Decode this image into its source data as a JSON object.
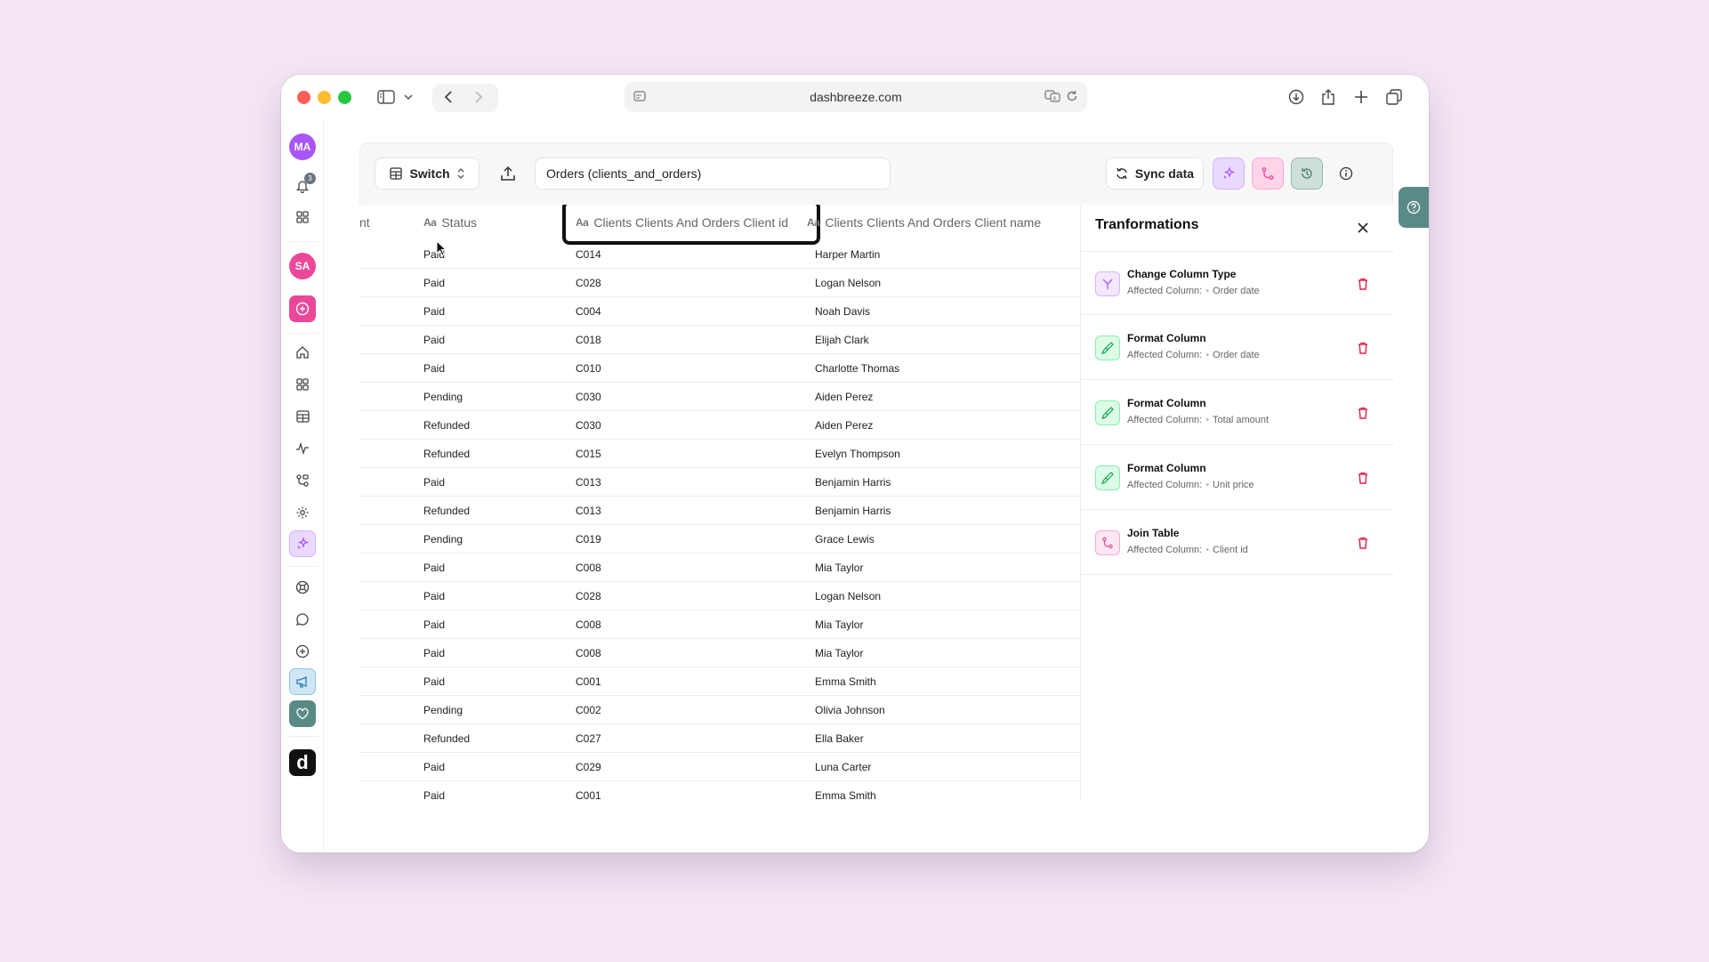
{
  "browser": {
    "url": "dashbreeze.com"
  },
  "sidebar": {
    "user_initials": "MA",
    "notification_count": "3",
    "workspace_initials": "SA",
    "logo_letter": "d"
  },
  "toolbar": {
    "switch_label": "Switch",
    "dataset_name": "Orders (clients_and_orders)",
    "sync_label": "Sync data"
  },
  "table": {
    "columns": [
      {
        "label": "nt"
      },
      {
        "label": "Status"
      },
      {
        "label": "Clients Clients And Orders Client id"
      },
      {
        "label": "Clients Clients And Orders Client name"
      }
    ],
    "type_marker": "Aa",
    "rows": [
      {
        "status": "Paid",
        "client_id": "C014",
        "client_name": "Harper Martin"
      },
      {
        "status": "Paid",
        "client_id": "C028",
        "client_name": "Logan Nelson"
      },
      {
        "status": "Paid",
        "client_id": "C004",
        "client_name": "Noah Davis"
      },
      {
        "status": "Paid",
        "client_id": "C018",
        "client_name": "Elijah Clark"
      },
      {
        "status": "Paid",
        "client_id": "C010",
        "client_name": "Charlotte Thomas"
      },
      {
        "status": "Pending",
        "client_id": "C030",
        "client_name": "Aiden Perez"
      },
      {
        "status": "Refunded",
        "client_id": "C030",
        "client_name": "Aiden Perez"
      },
      {
        "status": "Refunded",
        "client_id": "C015",
        "client_name": "Evelyn Thompson"
      },
      {
        "status": "Paid",
        "client_id": "C013",
        "client_name": "Benjamin Harris"
      },
      {
        "status": "Refunded",
        "client_id": "C013",
        "client_name": "Benjamin Harris"
      },
      {
        "status": "Pending",
        "client_id": "C019",
        "client_name": "Grace Lewis"
      },
      {
        "status": "Paid",
        "client_id": "C008",
        "client_name": "Mia Taylor"
      },
      {
        "status": "Paid",
        "client_id": "C028",
        "client_name": "Logan Nelson"
      },
      {
        "status": "Paid",
        "client_id": "C008",
        "client_name": "Mia Taylor"
      },
      {
        "status": "Paid",
        "client_id": "C008",
        "client_name": "Mia Taylor"
      },
      {
        "status": "Paid",
        "client_id": "C001",
        "client_name": "Emma Smith"
      },
      {
        "status": "Pending",
        "client_id": "C002",
        "client_name": "Olivia Johnson"
      },
      {
        "status": "Refunded",
        "client_id": "C027",
        "client_name": "Ella Baker"
      },
      {
        "status": "Paid",
        "client_id": "C029",
        "client_name": "Luna Carter"
      },
      {
        "status": "Paid",
        "client_id": "C001",
        "client_name": "Emma Smith"
      }
    ]
  },
  "transformations": {
    "title": "Tranformations",
    "affected_label": "Affected Column:",
    "items": [
      {
        "title": "Change Column Type",
        "column": "Order date",
        "icon": "branch-icon"
      },
      {
        "title": "Format Column",
        "column": "Order date",
        "icon": "brush-icon"
      },
      {
        "title": "Format Column",
        "column": "Total amount",
        "icon": "brush-icon"
      },
      {
        "title": "Format Column",
        "column": "Unit price",
        "icon": "brush-icon"
      },
      {
        "title": "Join Table",
        "column": "Client id",
        "icon": "join-icon"
      }
    ]
  },
  "colors": {
    "accent_purple": "#a855f7",
    "accent_pink": "#ec4899",
    "danger": "#e11d48",
    "help_tab": "#5a8a85"
  }
}
